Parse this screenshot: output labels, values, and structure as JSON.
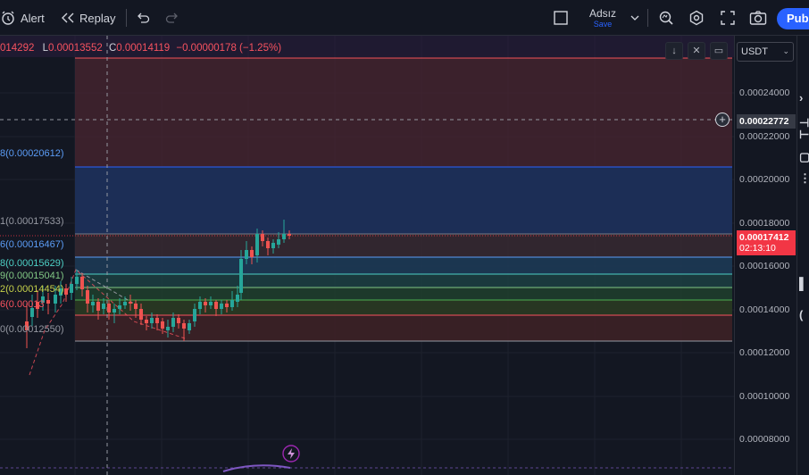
{
  "toolbar": {
    "alert_label": "Alert",
    "replay_label": "Replay",
    "layout_name": "Adsız",
    "layout_status": "Save",
    "publish_label": "Publ"
  },
  "legend": {
    "ohlc_partial": "014292",
    "low_prefix": "L",
    "low_value": "0.00013552",
    "close_prefix": "C",
    "close_value": "0.00014119",
    "change": "−0.00000178 (−1.25%)"
  },
  "currency_select": {
    "value": "USDT"
  },
  "price_axis": {
    "labels": [
      "0.00024000",
      "0.00022000",
      "0.00020000",
      "0.00018000",
      "0.00016000",
      "0.00014000",
      "0.00012000",
      "0.00010000",
      "0.00008000"
    ],
    "crosshair_price": "0.00022772",
    "last_price": "0.00017412",
    "countdown": "02:13:10"
  },
  "fib_labels": [
    {
      "text": "8(0.00020612)",
      "color": "#5b9cf6"
    },
    {
      "text": "1(0.00017533)",
      "color": "#9598a1"
    },
    {
      "text": "6(0.00016467)",
      "color": "#5b9cf6"
    },
    {
      "text": "8(0.00015629)",
      "color": "#4dd0c5"
    },
    {
      "text": "9(0.00015041)",
      "color": "#81c784"
    },
    {
      "text": "2(0.00014454)",
      "color": "#c6d14a"
    },
    {
      "text": "6(0.00013",
      "color": "#f7525f"
    },
    {
      "text": "0(0.00012550)",
      "color": "#9598a1"
    }
  ],
  "colors": {
    "up": "#26a69a",
    "down": "#ef5350",
    "accent": "#2962ff",
    "price_tag": "#f23645"
  },
  "icons": [
    "alarm-clock-icon",
    "replay-icon",
    "undo-icon",
    "redo-icon",
    "layout-square-icon",
    "chevron-down-icon",
    "quick-search-icon",
    "settings-hex-icon",
    "fullscreen-icon",
    "camera-icon",
    "arrow-down-icon",
    "collapse-icon",
    "reset-icon",
    "add-circle-icon",
    "lightning-icon"
  ]
}
